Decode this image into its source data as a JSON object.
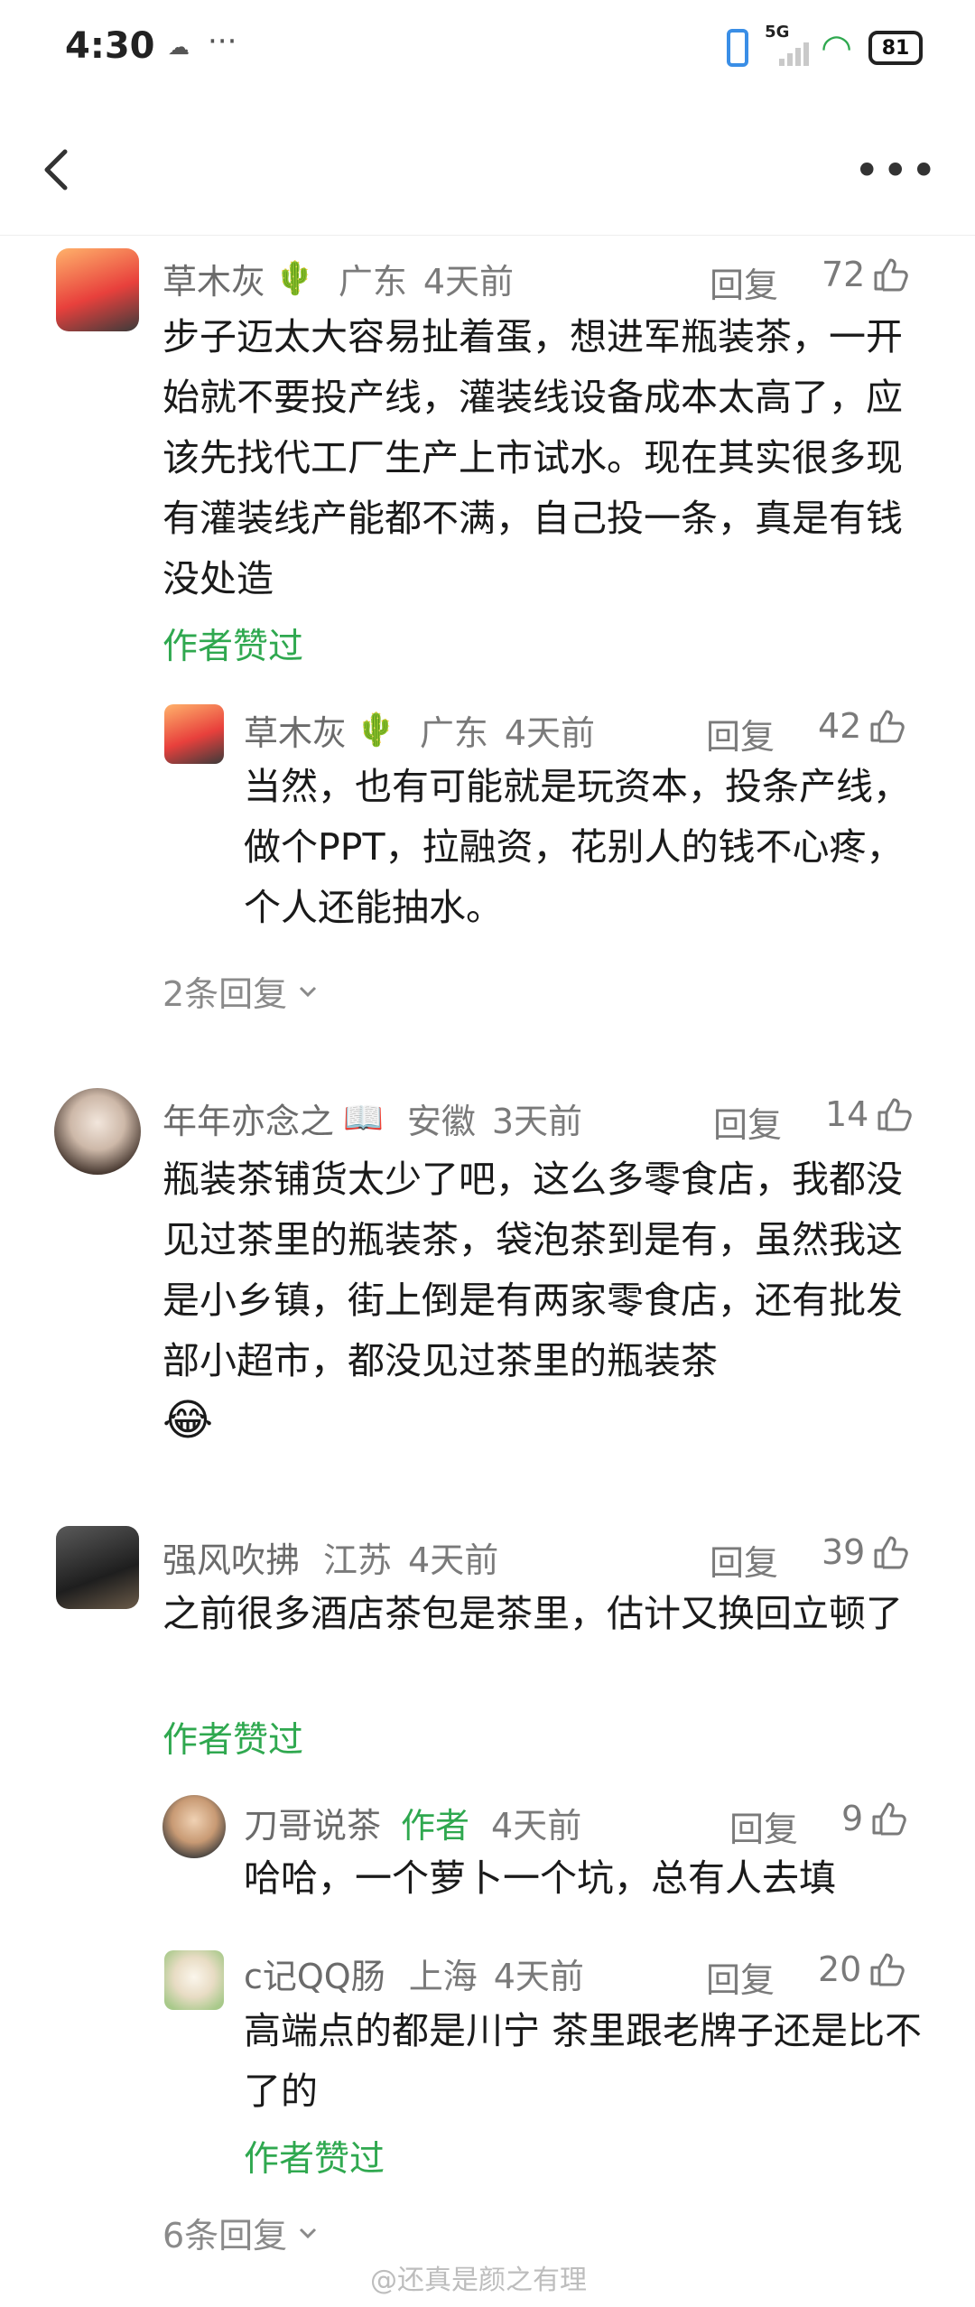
{
  "status": {
    "time": "4:30",
    "signal": "5G",
    "battery": "81"
  },
  "comments": [
    {
      "name": "草木灰",
      "badge": "🌵",
      "loc": "广东",
      "time": "4天前",
      "reply": "回复",
      "likes": "72",
      "text": "步子迈太大容易扯着蛋，想进军瓶装茶，一开始就不要投产线，灌装线设备成本太高了，应该先找代工厂生产上市试水。现在其实很多现有灌装线产能都不满，自己投一条，真是有钱没处造",
      "liked_by": "作者赞过"
    },
    {
      "name": "草木灰",
      "badge": "🌵",
      "loc": "广东",
      "time": "4天前",
      "reply": "回复",
      "likes": "42",
      "text": "当然，也有可能就是玩资本，投条产线，做个PPT，拉融资，花别人的钱不心疼，个人还能抽水。"
    },
    {
      "name": "年年亦念之",
      "badge": "📖",
      "loc": "安徽",
      "time": "3天前",
      "reply": "回复",
      "likes": "14",
      "text": "瓶装茶铺货太少了吧，这么多零食店，我都没见过茶里的瓶装茶，袋泡茶到是有，虽然我这是小乡镇，街上倒是有两家零食店，还有批发部小超市，都没见过茶里的瓶装茶",
      "emoji": "😂"
    },
    {
      "name": "强风吹拂",
      "loc": "江苏",
      "time": "4天前",
      "reply": "回复",
      "likes": "39",
      "text": "之前很多酒店茶包是茶里，估计又换回立顿了",
      "liked_by": "作者赞过"
    },
    {
      "name": "刀哥说茶",
      "author_tag": "作者",
      "time": "4天前",
      "reply": "回复",
      "likes": "9",
      "text": "哈哈，一个萝卜一个坑，总有人去填"
    },
    {
      "name": "c记QQ肠",
      "loc": "上海",
      "time": "4天前",
      "reply": "回复",
      "likes": "20",
      "text": "高端点的都是川宁 茶里跟老牌子还是比不了的",
      "liked_by": "作者赞过"
    }
  ],
  "expand1": "2条回复",
  "expand2": "6条回复",
  "watermark": "@还真是颜之有理"
}
